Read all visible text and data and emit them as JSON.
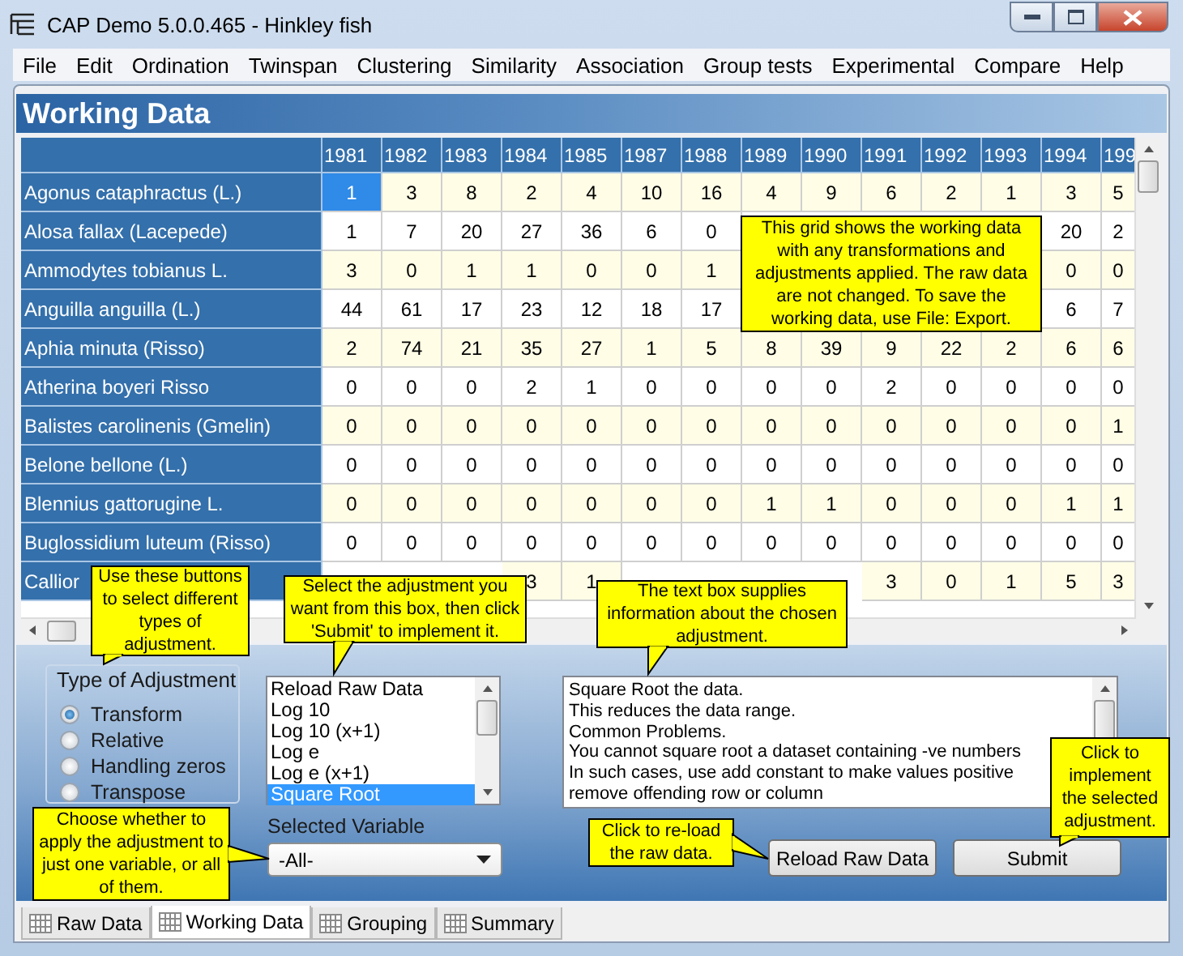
{
  "window": {
    "title": "CAP Demo 5.0.0.465 - Hinkley fish"
  },
  "menu": [
    "File",
    "Edit",
    "Ordination",
    "Twinspan",
    "Clustering",
    "Similarity",
    "Association",
    "Group tests",
    "Experimental",
    "Compare",
    "Help"
  ],
  "panel_title": "Working Data",
  "grid": {
    "columns": [
      "1981",
      "1982",
      "1983",
      "1984",
      "1985",
      "1987",
      "1988",
      "1989",
      "1990",
      "1991",
      "1992",
      "1993",
      "1994",
      "199"
    ],
    "rows": [
      {
        "name": "Agonus cataphractus (L.)",
        "cells": [
          {
            "value": "1",
            "selected": true
          },
          {
            "value": "3",
            "selected": false
          },
          {
            "value": "8",
            "selected": false
          },
          {
            "value": "2",
            "selected": false
          },
          {
            "value": "4",
            "selected": false
          },
          {
            "value": "10",
            "selected": false
          },
          {
            "value": "16",
            "selected": false
          },
          {
            "value": "4",
            "selected": false
          },
          {
            "value": "9",
            "selected": false
          },
          {
            "value": "6",
            "selected": false
          },
          {
            "value": "2",
            "selected": false
          },
          {
            "value": "1",
            "selected": false
          },
          {
            "value": "3",
            "selected": false
          },
          {
            "value": "5",
            "selected": false
          }
        ]
      },
      {
        "name": "Alosa fallax (Lacepede)",
        "cells": [
          {
            "value": "1",
            "selected": false
          },
          {
            "value": "7",
            "selected": false
          },
          {
            "value": "20",
            "selected": false
          },
          {
            "value": "27",
            "selected": false
          },
          {
            "value": "36",
            "selected": false
          },
          {
            "value": "6",
            "selected": false
          },
          {
            "value": "0",
            "selected": false
          },
          null,
          null,
          null,
          null,
          null,
          {
            "value": "20",
            "selected": false
          },
          {
            "value": "2",
            "selected": false
          }
        ]
      },
      {
        "name": "Ammodytes tobianus L.",
        "cells": [
          {
            "value": "3",
            "selected": false
          },
          {
            "value": "0",
            "selected": false
          },
          {
            "value": "1",
            "selected": false
          },
          {
            "value": "1",
            "selected": false
          },
          {
            "value": "0",
            "selected": false
          },
          {
            "value": "0",
            "selected": false
          },
          {
            "value": "1",
            "selected": false
          },
          null,
          null,
          null,
          null,
          null,
          {
            "value": "0",
            "selected": false
          },
          {
            "value": "0",
            "selected": false
          }
        ]
      },
      {
        "name": "Anguilla anguilla (L.)",
        "cells": [
          {
            "value": "44",
            "selected": false
          },
          {
            "value": "61",
            "selected": false
          },
          {
            "value": "17",
            "selected": false
          },
          {
            "value": "23",
            "selected": false
          },
          {
            "value": "12",
            "selected": false
          },
          {
            "value": "18",
            "selected": false
          },
          {
            "value": "17",
            "selected": false
          },
          null,
          null,
          null,
          null,
          null,
          {
            "value": "6",
            "selected": false
          },
          {
            "value": "7",
            "selected": false
          }
        ]
      },
      {
        "name": "Aphia minuta (Risso)",
        "cells": [
          {
            "value": "2",
            "selected": false
          },
          {
            "value": "74",
            "selected": false
          },
          {
            "value": "21",
            "selected": false
          },
          {
            "value": "35",
            "selected": false
          },
          {
            "value": "27",
            "selected": false
          },
          {
            "value": "1",
            "selected": false
          },
          {
            "value": "5",
            "selected": false
          },
          {
            "value": "8",
            "selected": false
          },
          {
            "value": "39",
            "selected": false
          },
          {
            "value": "9",
            "selected": false
          },
          {
            "value": "22",
            "selected": false
          },
          {
            "value": "2",
            "selected": false
          },
          {
            "value": "6",
            "selected": false
          },
          {
            "value": "6",
            "selected": false
          }
        ]
      },
      {
        "name": "Atherina boyeri Risso",
        "cells": [
          {
            "value": "0",
            "selected": false
          },
          {
            "value": "0",
            "selected": false
          },
          {
            "value": "0",
            "selected": false
          },
          {
            "value": "2",
            "selected": false
          },
          {
            "value": "1",
            "selected": false
          },
          {
            "value": "0",
            "selected": false
          },
          {
            "value": "0",
            "selected": false
          },
          {
            "value": "0",
            "selected": false
          },
          {
            "value": "0",
            "selected": false
          },
          {
            "value": "2",
            "selected": false
          },
          {
            "value": "0",
            "selected": false
          },
          {
            "value": "0",
            "selected": false
          },
          {
            "value": "0",
            "selected": false
          },
          {
            "value": "0",
            "selected": false
          }
        ]
      },
      {
        "name": "Balistes carolinenis (Gmelin)",
        "cells": [
          {
            "value": "0",
            "selected": false
          },
          {
            "value": "0",
            "selected": false
          },
          {
            "value": "0",
            "selected": false
          },
          {
            "value": "0",
            "selected": false
          },
          {
            "value": "0",
            "selected": false
          },
          {
            "value": "0",
            "selected": false
          },
          {
            "value": "0",
            "selected": false
          },
          {
            "value": "0",
            "selected": false
          },
          {
            "value": "0",
            "selected": false
          },
          {
            "value": "0",
            "selected": false
          },
          {
            "value": "0",
            "selected": false
          },
          {
            "value": "0",
            "selected": false
          },
          {
            "value": "0",
            "selected": false
          },
          {
            "value": "1",
            "selected": false
          }
        ]
      },
      {
        "name": "Belone bellone (L.)",
        "cells": [
          {
            "value": "0",
            "selected": false
          },
          {
            "value": "0",
            "selected": false
          },
          {
            "value": "0",
            "selected": false
          },
          {
            "value": "0",
            "selected": false
          },
          {
            "value": "0",
            "selected": false
          },
          {
            "value": "0",
            "selected": false
          },
          {
            "value": "0",
            "selected": false
          },
          {
            "value": "0",
            "selected": false
          },
          {
            "value": "0",
            "selected": false
          },
          {
            "value": "0",
            "selected": false
          },
          {
            "value": "0",
            "selected": false
          },
          {
            "value": "0",
            "selected": false
          },
          {
            "value": "0",
            "selected": false
          },
          {
            "value": "0",
            "selected": false
          }
        ]
      },
      {
        "name": "Blennius gattorugine L.",
        "cells": [
          {
            "value": "0",
            "selected": false
          },
          {
            "value": "0",
            "selected": false
          },
          {
            "value": "0",
            "selected": false
          },
          {
            "value": "0",
            "selected": false
          },
          {
            "value": "0",
            "selected": false
          },
          {
            "value": "0",
            "selected": false
          },
          {
            "value": "0",
            "selected": false
          },
          {
            "value": "1",
            "selected": false
          },
          {
            "value": "1",
            "selected": false
          },
          {
            "value": "0",
            "selected": false
          },
          {
            "value": "0",
            "selected": false
          },
          {
            "value": "0",
            "selected": false
          },
          {
            "value": "1",
            "selected": false
          },
          {
            "value": "1",
            "selected": false
          }
        ]
      },
      {
        "name": "Buglossidium luteum (Risso)",
        "cells": [
          {
            "value": "0",
            "selected": false
          },
          {
            "value": "0",
            "selected": false
          },
          {
            "value": "0",
            "selected": false
          },
          {
            "value": "0",
            "selected": false
          },
          {
            "value": "0",
            "selected": false
          },
          {
            "value": "0",
            "selected": false
          },
          {
            "value": "0",
            "selected": false
          },
          {
            "value": "0",
            "selected": false
          },
          {
            "value": "0",
            "selected": false
          },
          {
            "value": "0",
            "selected": false
          },
          {
            "value": "0",
            "selected": false
          },
          {
            "value": "0",
            "selected": false
          },
          {
            "value": "0",
            "selected": false
          },
          {
            "value": "0",
            "selected": false
          }
        ]
      },
      {
        "name": "Callior",
        "cells": [
          null,
          null,
          null,
          {
            "value": "3",
            "selected": false
          },
          {
            "value": "1",
            "selected": false
          },
          null,
          null,
          null,
          null,
          {
            "value": "3",
            "selected": false
          },
          {
            "value": "0",
            "selected": false
          },
          {
            "value": "1",
            "selected": false
          },
          {
            "value": "5",
            "selected": false
          },
          {
            "value": "3",
            "selected": false
          }
        ]
      }
    ]
  },
  "adjustment_type": {
    "label": "Type of Adjustment",
    "options": [
      {
        "label": "Transform",
        "selected": true
      },
      {
        "label": "Relative",
        "selected": false
      },
      {
        "label": "Handling zeros",
        "selected": false
      },
      {
        "label": "Transpose",
        "selected": false
      }
    ]
  },
  "adjustment_list": {
    "items": [
      {
        "label": "Reload Raw Data",
        "selected": false
      },
      {
        "label": "Log 10",
        "selected": false
      },
      {
        "label": "Log 10 (x+1)",
        "selected": false
      },
      {
        "label": "Log e",
        "selected": false
      },
      {
        "label": "Log e (x+1)",
        "selected": false
      },
      {
        "label": "Square Root",
        "selected": true
      }
    ]
  },
  "selected_variable": {
    "label": "Selected Variable",
    "value": "-All-"
  },
  "info_text": {
    "lines": [
      "Square Root the data.",
      "This reduces the data range.",
      "Common Problems.",
      "You cannot square root a dataset containing -ve numbers",
      "In such cases, use add constant to make values positive",
      "remove offending row or column"
    ]
  },
  "buttons": [
    "Reload Raw Data",
    "Submit"
  ],
  "callouts": [
    {
      "text": "This grid shows the working data with any transformations and adjustments applied. The raw data are not changed. To save the working data, use File: Export.",
      "kind": "plain"
    },
    {
      "text": "Use these buttons to select different types of adjustment.",
      "kind": "down"
    },
    {
      "text": "Select the adjustment you want from this box, then click 'Submit' to implement it.",
      "kind": "down"
    },
    {
      "text": "The text box supplies information about the chosen adjustment.",
      "kind": "down"
    },
    {
      "text": "Choose whether to apply the adjustment to just one variable, or all of them.",
      "kind": "right"
    },
    {
      "text": "Click to re-load the raw data.",
      "kind": "right"
    },
    {
      "text": "Click to implement the selected adjustment.",
      "kind": "down"
    }
  ],
  "tabs": [
    {
      "label": "Raw Data",
      "selected": false
    },
    {
      "label": "Working Data",
      "selected": true
    },
    {
      "label": "Grouping",
      "selected": false
    },
    {
      "label": "Summary",
      "selected": false
    }
  ]
}
